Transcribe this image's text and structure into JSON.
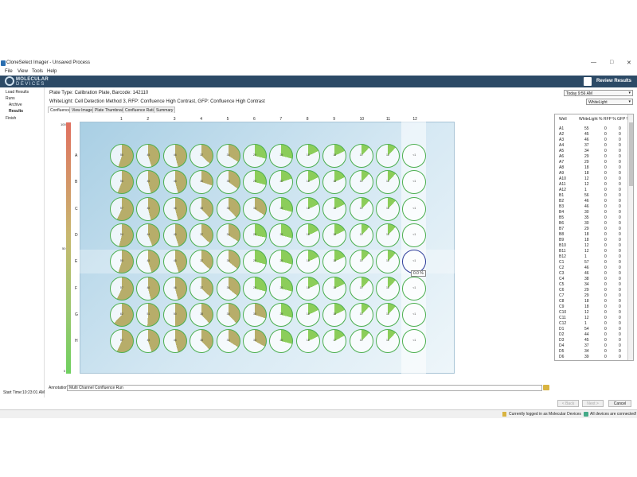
{
  "window": {
    "title": "CloneSelect Imager - Unsaved Process",
    "minimize": "—",
    "maximize": "□",
    "close": "✕"
  },
  "menu": [
    "File",
    "View",
    "Tools",
    "Help"
  ],
  "banner": {
    "logo_line1": "MOLECULAR",
    "logo_line2": "DEVICES",
    "section": "Review Results"
  },
  "sidebar": {
    "items": [
      "Load Results",
      "Runs",
      "Archive",
      "Results",
      "Finish"
    ],
    "start_time_label": "Start Time:",
    "start_time": "10:23:01 AM"
  },
  "header": {
    "plate_info": "Plate Type: Calibration Plate, Barcode: 142110",
    "method_info": "WhiteLight: Cell Detection Method 3, RFP: Confluence High Contrast, GFP: Confluence High Contrast",
    "time_select": "Today 9:56 AM",
    "channel_select": "WhiteLight"
  },
  "tabs": [
    "Confluence",
    "View Image",
    "Plate Thumbnails",
    "Confluence Ratio",
    "Summary"
  ],
  "plate": {
    "columns": [
      "1",
      "2",
      "3",
      "4",
      "5",
      "6",
      "7",
      "8",
      "9",
      "10",
      "11",
      "12"
    ],
    "rows": [
      "A",
      "B",
      "C",
      "D",
      "E",
      "F",
      "G",
      "H"
    ],
    "scale_max": "100",
    "scale_mid": "50",
    "scale_min": "0",
    "tooltip": "0.0 %",
    "wells": {
      "A": [
        "55",
        "45",
        "46",
        "37",
        "34",
        "29",
        "29",
        "18",
        "18",
        "12",
        "12",
        "<1"
      ],
      "B": [
        "56",
        "46",
        "46",
        "30",
        "35",
        "29",
        "20",
        "18",
        "18",
        "12",
        "12",
        "<1"
      ],
      "C": [
        "57",
        "46",
        "46",
        "38",
        "38",
        "34",
        "29",
        "18",
        "18",
        "12",
        "12",
        "<1"
      ],
      "D": [
        "54",
        "44",
        "45",
        "37",
        "34",
        "28",
        "29",
        "18",
        "18",
        "12",
        "12",
        "<1"
      ],
      "E": [
        "55",
        "45",
        "45",
        "37",
        "36",
        "29",
        "29",
        "18",
        "18",
        "12",
        "12",
        "<1"
      ],
      "F": [
        "57",
        "46",
        "46",
        "37",
        "36",
        "29",
        "29",
        "18",
        "18",
        "12",
        "12",
        "<1"
      ],
      "G": [
        "62",
        "51",
        "50",
        "38",
        "38",
        "30",
        "29",
        "18",
        "18",
        "12",
        "12",
        "<1"
      ],
      "H": [
        "57",
        "45",
        "46",
        "38",
        "34",
        "33",
        "29",
        "18",
        "17",
        "12",
        "12",
        "<1"
      ]
    }
  },
  "results_table": {
    "headers": [
      "Well",
      "WhiteLight %",
      "RFP %",
      "GFP %"
    ],
    "rows": [
      [
        "A1",
        "55",
        "0",
        "0"
      ],
      [
        "A2",
        "45",
        "0",
        "0"
      ],
      [
        "A3",
        "46",
        "0",
        "0"
      ],
      [
        "A4",
        "37",
        "0",
        "0"
      ],
      [
        "A5",
        "34",
        "0",
        "0"
      ],
      [
        "A6",
        "29",
        "0",
        "0"
      ],
      [
        "A7",
        "29",
        "0",
        "0"
      ],
      [
        "A8",
        "18",
        "0",
        "0"
      ],
      [
        "A9",
        "18",
        "0",
        "0"
      ],
      [
        "A10",
        "12",
        "0",
        "0"
      ],
      [
        "A11",
        "12",
        "0",
        "0"
      ],
      [
        "A12",
        "1",
        "0",
        "0"
      ],
      [
        "B1",
        "56",
        "0",
        "0"
      ],
      [
        "B2",
        "46",
        "0",
        "0"
      ],
      [
        "B3",
        "46",
        "0",
        "0"
      ],
      [
        "B4",
        "30",
        "0",
        "0"
      ],
      [
        "B5",
        "35",
        "0",
        "0"
      ],
      [
        "B6",
        "30",
        "0",
        "0"
      ],
      [
        "B7",
        "29",
        "0",
        "0"
      ],
      [
        "B8",
        "18",
        "0",
        "0"
      ],
      [
        "B9",
        "18",
        "0",
        "0"
      ],
      [
        "B10",
        "12",
        "0",
        "0"
      ],
      [
        "B11",
        "12",
        "0",
        "0"
      ],
      [
        "B12",
        "1",
        "0",
        "0"
      ],
      [
        "C1",
        "57",
        "0",
        "0"
      ],
      [
        "C2",
        "46",
        "0",
        "0"
      ],
      [
        "C3",
        "46",
        "0",
        "0"
      ],
      [
        "C4",
        "38",
        "0",
        "0"
      ],
      [
        "C5",
        "34",
        "0",
        "0"
      ],
      [
        "C6",
        "29",
        "0",
        "0"
      ],
      [
        "C7",
        "29",
        "0",
        "0"
      ],
      [
        "C8",
        "18",
        "0",
        "0"
      ],
      [
        "C9",
        "18",
        "0",
        "0"
      ],
      [
        "C10",
        "12",
        "0",
        "0"
      ],
      [
        "C11",
        "12",
        "0",
        "0"
      ],
      [
        "C12",
        "1",
        "0",
        "0"
      ],
      [
        "D1",
        "54",
        "0",
        "0"
      ],
      [
        "D2",
        "44",
        "0",
        "0"
      ],
      [
        "D3",
        "45",
        "0",
        "0"
      ],
      [
        "D4",
        "37",
        "0",
        "0"
      ],
      [
        "D5",
        "34",
        "0",
        "0"
      ],
      [
        "D6",
        "39",
        "0",
        "0"
      ]
    ]
  },
  "annotation": {
    "label": "Annotation:",
    "value": "Multi Channel Confluence Run"
  },
  "buttons": {
    "back": "< Back",
    "next": "Next >",
    "cancel": "Cancel"
  },
  "status": {
    "login": "Currently logged in as Molecular Devices",
    "devices": "All devices are connected!"
  },
  "colors": {
    "banner": "#2c4a66",
    "confluence_fill": "#8ccd5a",
    "high_fill": "#b7ad6a",
    "well_border": "#4caf50"
  }
}
